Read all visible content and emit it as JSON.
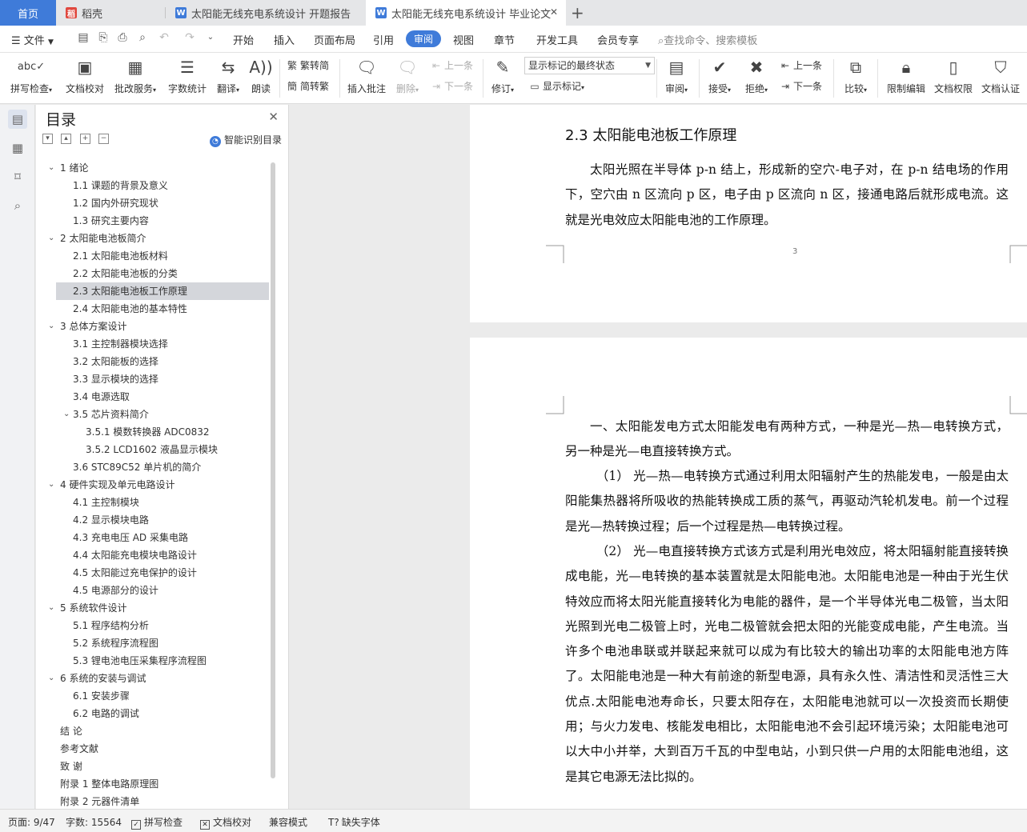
{
  "tabs": [
    {
      "label": "首页",
      "icon": "home-tab"
    },
    {
      "label": "稻壳",
      "icon": "docer-icon"
    },
    {
      "label": "太阳能无线充电系统设计 开题报告",
      "icon": "writer-doc-icon"
    },
    {
      "label": "太阳能无线充电系统设计 毕业论文",
      "icon": "writer-doc-icon",
      "active": true
    }
  ],
  "new_tab": "+",
  "menubar": {
    "file": "文件",
    "items": [
      "开始",
      "插入",
      "页面布局",
      "引用",
      "审阅",
      "视图",
      "章节",
      "开发工具",
      "会员专享"
    ],
    "active": "审阅",
    "search_placeholder": "查找命令、搜索模板"
  },
  "toolbar": {
    "spellcheck": "拼写检查",
    "doc_proof": "文档校对",
    "annotate_service": "批改服务",
    "word_count": "字数统计",
    "translate": "翻译",
    "read_aloud": "朗读",
    "to_traditional": "繁转简",
    "to_simplified": "简转繁",
    "insert_comment": "插入批注",
    "delete": "删除",
    "prev_comment": "上一条",
    "next_comment": "下一条",
    "track_changes": "修订",
    "display_mode": "显示标记的最终状态",
    "show_markup": "显示标记",
    "review": "审阅",
    "accept": "接受",
    "reject": "拒绝",
    "prev_change": "上一条",
    "next_change": "下一条",
    "compare": "比较",
    "restrict_edit": "限制编辑",
    "doc_permission": "文档权限",
    "doc_certify": "文档认证"
  },
  "toc": {
    "title": "目录",
    "smart_label": "智能识别目录",
    "items": [
      {
        "text": "1  绪论",
        "level": 1,
        "expanded": true
      },
      {
        "text": "1.1 课题的背景及意义",
        "level": 2
      },
      {
        "text": "1.2 国内外研究现状",
        "level": 2
      },
      {
        "text": "1.3 研究主要内容",
        "level": 2
      },
      {
        "text": "2  太阳能电池板简介",
        "level": 1,
        "expanded": true
      },
      {
        "text": "2.1 太阳能电池板材料",
        "level": 2
      },
      {
        "text": "2.2 太阳能电池板的分类",
        "level": 2
      },
      {
        "text": "2.3 太阳能电池板工作原理",
        "level": 2,
        "selected": true
      },
      {
        "text": "2.4 太阳能电池的基本特性",
        "level": 2
      },
      {
        "text": "3  总体方案设计",
        "level": 1,
        "expanded": true
      },
      {
        "text": "3.1 主控制器模块选择",
        "level": 2
      },
      {
        "text": "3.2 太阳能板的选择",
        "level": 2
      },
      {
        "text": "3.3 显示模块的选择",
        "level": 2
      },
      {
        "text": "3.4 电源选取",
        "level": 2
      },
      {
        "text": "3.5 芯片资料简介",
        "level": 2,
        "expanded": true
      },
      {
        "text": "3.5.1 模数转换器 ADC0832",
        "level": 3
      },
      {
        "text": "3.5.2 LCD1602 液晶显示模块",
        "level": 3
      },
      {
        "text": "3.6 STC89C52 单片机的简介",
        "level": 2
      },
      {
        "text": "4  硬件实现及单元电路设计",
        "level": 1,
        "expanded": true
      },
      {
        "text": "4.1 主控制模块",
        "level": 2
      },
      {
        "text": "4.2 显示模块电路",
        "level": 2
      },
      {
        "text": "4.3 充电电压 AD 采集电路",
        "level": 2
      },
      {
        "text": "4.4 太阳能充电模块电路设计",
        "level": 2
      },
      {
        "text": "4.5 太阳能过充电保护的设计",
        "level": 2
      },
      {
        "text": "4.5 电源部分的设计",
        "level": 2
      },
      {
        "text": "5  系统软件设计",
        "level": 1,
        "expanded": true
      },
      {
        "text": "5.1 程序结构分析",
        "level": 2
      },
      {
        "text": "5.2 系统程序流程图",
        "level": 2
      },
      {
        "text": "5.3 锂电池电压采集程序流程图",
        "level": 2
      },
      {
        "text": "6  系统的安装与调试",
        "level": 1,
        "expanded": true
      },
      {
        "text": "6.1 安装步骤",
        "level": 2
      },
      {
        "text": "6.2 电路的调试",
        "level": 2
      },
      {
        "text": "结  论",
        "level": 0
      },
      {
        "text": "参考文献",
        "level": 0
      },
      {
        "text": "致  谢",
        "level": 0
      },
      {
        "text": "附录 1 整体电路原理图",
        "level": 0
      },
      {
        "text": "附录 2 元器件清单",
        "level": 0
      }
    ]
  },
  "document": {
    "heading": "2.3 太阳能电池板工作原理",
    "page1_para": "太阳光照在半导体 p-n 结上，形成新的空穴-电子对，在 p-n 结电场的作用下，空穴由 n 区流向 p 区，电子由 p 区流向 n 区，接通电路后就形成电流。这就是光电效应太阳能电池的工作原理。",
    "page_number": "3",
    "page2_paras": [
      "一、太阳能发电方式太阳能发电有两种方式，一种是光—热—电转换方式，另一种是光—电直接转换方式。",
      "（1）  光—热—电转换方式通过利用太阳辐射产生的热能发电，一般是由太阳能集热器将所吸收的热能转换成工质的蒸气，再驱动汽轮机发电。前一个过程是光—热转换过程；后一个过程是热—电转换过程。",
      "（2）  光—电直接转换方式该方式是利用光电效应，将太阳辐射能直接转换成电能，光—电转换的基本装置就是太阳能电池。太阳能电池是一种由于光生伏特效应而将太阳光能直接转化为电能的器件，是一个半导体光电二极管，当太阳光照到光电二极管上时，光电二极管就会把太阳的光能变成电能，产生电流。当许多个电池串联或并联起来就可以成为有比较大的输出功率的太阳能电池方阵了。太阳能电池是一种大有前途的新型电源，具有永久性、清洁性和灵活性三大优点.太阳能电池寿命长，只要太阳存在，太阳能电池就可以一次投资而长期使用；与火力发电、核能发电相比，太阳能电池不会引起环境污染；太阳能电池可以大中小并举，大到百万千瓦的中型电站，小到只供一户用的太阳能电池组，这是其它电源无法比拟的。"
    ]
  },
  "statusbar": {
    "page": "页面: 9/47",
    "words": "字数: 15564",
    "spellcheck": "拼写检查",
    "doc_proof": "文档校对",
    "compat": "兼容模式",
    "missing_font": "缺失字体"
  },
  "colors": {
    "accent": "#3f7bd9",
    "docer": "#e0483e",
    "tab_bg": "#e5e6e8",
    "selected_toc": "#d4d6db"
  }
}
